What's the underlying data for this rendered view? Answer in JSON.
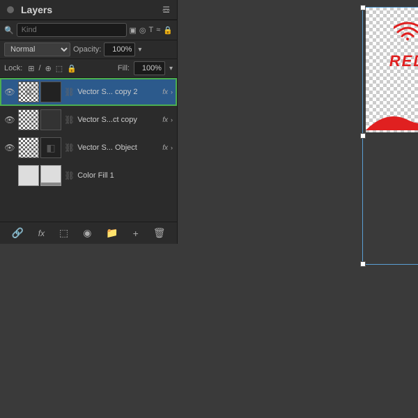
{
  "panel": {
    "title": "Layers",
    "close_label": "×",
    "collapse_label": "«»",
    "menu_label": "☰"
  },
  "search": {
    "placeholder": "Kind",
    "filter_icons": [
      "☷",
      "◎",
      "T",
      "≈",
      "🔒"
    ]
  },
  "blend": {
    "mode": "Normal",
    "opacity_label": "Opacity:",
    "opacity_value": "100%",
    "opacity_arrow": "▾"
  },
  "lock": {
    "label": "Lock:",
    "icons": [
      "⊞",
      "/",
      "⊕",
      "⬚",
      "🔒"
    ],
    "fill_label": "Fill:",
    "fill_value": "100%",
    "fill_arrow": "▾"
  },
  "layers": [
    {
      "id": "layer-1",
      "name": "Vector S... copy 2",
      "visible": true,
      "selected": true,
      "has_fx": true,
      "thumb_type": "checkerboard",
      "thumb2_type": "black"
    },
    {
      "id": "layer-2",
      "name": "Vector S...ct copy",
      "visible": true,
      "selected": false,
      "has_fx": true,
      "thumb_type": "checkerboard",
      "thumb2_type": "dark"
    },
    {
      "id": "layer-3",
      "name": "Vector S... Object",
      "visible": true,
      "selected": false,
      "has_fx": true,
      "thumb_type": "checkerboard",
      "thumb2_type": "dark"
    },
    {
      "id": "layer-4",
      "name": "Color Fill 1",
      "visible": false,
      "selected": false,
      "has_fx": false,
      "thumb_type": "white",
      "thumb2_type": "white"
    }
  ],
  "toolbar": {
    "link_label": "🔗",
    "fx_label": "fx",
    "new_group_label": "⬚",
    "mask_label": "◉",
    "folder_label": "📁",
    "delete_label": "🗑",
    "new_layer_label": "+"
  },
  "canvas": {
    "card": {
      "wifi_color": "#e02020",
      "red_text": "RED",
      "wave_color": "#e02020"
    },
    "selection": {
      "visible": true
    }
  }
}
